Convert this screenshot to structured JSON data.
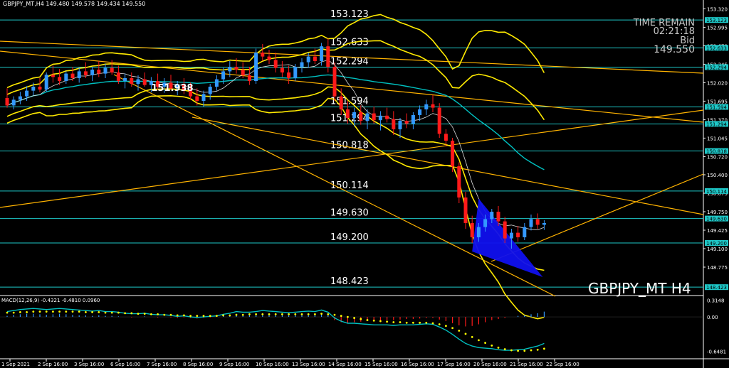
{
  "header": {
    "text": "GBPJPY_MT,H4  149.480 149.578 149.434 149.550"
  },
  "overlay": {
    "time_remain_label": "TIME REMAIN",
    "time_remain": "02:21:18",
    "bid_label": "Bid",
    "bid": "149.550"
  },
  "symbol_label": "GBPJPY_MT H4",
  "macd_label": "MACD(12,26,9) -0.4321 -0.4810 0.0960",
  "colors": {
    "bull": "#3399ff",
    "bear": "#ff1a1a",
    "band": "#ffea00",
    "trend": "#ffb300",
    "level": "#1ec8c8",
    "ma": "#00c0c0",
    "triangle": "#1010ee",
    "signal": "#ffff00"
  },
  "chart_data": {
    "type": "candlestick",
    "symbol": "GBPJPY_MT",
    "timeframe": "H4",
    "ylim": [
      148.3,
      153.35
    ],
    "y_ticks": [
      "153.320",
      "152.995",
      "152.670",
      "152.345",
      "152.020",
      "151.695",
      "151.370",
      "151.045",
      "150.720",
      "150.400",
      "150.075",
      "149.750",
      "149.425",
      "149.100",
      "148.775"
    ],
    "x_ticks": [
      "1 Sep 2021",
      "2 Sep 16:00",
      "3 Sep 16:00",
      "6 Sep 16:00",
      "7 Sep 16:00",
      "8 Sep 16:00",
      "9 Sep 16:00",
      "10 Sep 16:00",
      "13 Sep 16:00",
      "14 Sep 16:00",
      "15 Sep 16:00",
      "16 Sep 16:00",
      "17 Sep 16:00",
      "20 Sep 16:00",
      "21 Sep 16:00",
      "22 Sep 16:00"
    ],
    "levels": [
      {
        "value": 153.123,
        "label": "153.123"
      },
      {
        "value": 152.633,
        "label": "152.633"
      },
      {
        "value": 152.294,
        "label": "152.294"
      },
      {
        "value": 151.594,
        "label": "151.594"
      },
      {
        "value": 151.294,
        "label": "151.294"
      },
      {
        "value": 150.818,
        "label": "150.818"
      },
      {
        "value": 150.114,
        "label": "150.114"
      },
      {
        "value": 149.63,
        "label": "149.630"
      },
      {
        "value": 149.2,
        "label": "149.200"
      },
      {
        "value": 148.423,
        "label": "148.423"
      }
    ],
    "annotation": {
      "label": "151.938",
      "bar": 27,
      "value": 151.938
    },
    "candles": [
      [
        151.75,
        151.92,
        151.58,
        151.62
      ],
      [
        151.62,
        151.78,
        151.55,
        151.72
      ],
      [
        151.72,
        151.86,
        151.64,
        151.78
      ],
      [
        151.78,
        151.96,
        151.7,
        151.88
      ],
      [
        151.88,
        152.02,
        151.8,
        151.95
      ],
      [
        151.95,
        152.1,
        151.85,
        151.9
      ],
      [
        151.9,
        152.2,
        151.86,
        152.16
      ],
      [
        152.16,
        152.32,
        152.02,
        152.12
      ],
      [
        152.12,
        152.26,
        151.98,
        152.05
      ],
      [
        152.05,
        152.22,
        152.0,
        152.18
      ],
      [
        152.18,
        152.3,
        152.05,
        152.1
      ],
      [
        152.1,
        152.28,
        152.02,
        152.22
      ],
      [
        152.22,
        152.38,
        152.1,
        152.15
      ],
      [
        152.15,
        152.3,
        152.05,
        152.25
      ],
      [
        152.25,
        152.4,
        152.12,
        152.18
      ],
      [
        152.18,
        152.35,
        152.1,
        152.28
      ],
      [
        152.28,
        152.42,
        152.16,
        152.2
      ],
      [
        152.2,
        152.32,
        152.0,
        152.05
      ],
      [
        152.05,
        152.18,
        151.92,
        152.1
      ],
      [
        152.1,
        152.2,
        151.95,
        152.0
      ],
      [
        152.0,
        152.15,
        151.88,
        152.08
      ],
      [
        152.08,
        152.2,
        151.95,
        151.98
      ],
      [
        151.98,
        152.12,
        151.85,
        152.05
      ],
      [
        152.05,
        152.18,
        151.9,
        151.95
      ],
      [
        151.95,
        152.1,
        151.84,
        152.02
      ],
      [
        152.02,
        152.16,
        151.9,
        151.92
      ],
      [
        151.92,
        152.05,
        151.8,
        151.98
      ],
      [
        151.98,
        152.1,
        151.82,
        151.9
      ],
      [
        151.9,
        152.02,
        151.72,
        151.78
      ],
      [
        151.78,
        151.92,
        151.62,
        151.7
      ],
      [
        151.7,
        151.88,
        151.6,
        151.82
      ],
      [
        151.82,
        152.0,
        151.72,
        151.95
      ],
      [
        151.95,
        152.15,
        151.88,
        152.08
      ],
      [
        152.08,
        152.28,
        152.0,
        152.22
      ],
      [
        152.22,
        152.4,
        152.12,
        152.3
      ],
      [
        152.3,
        152.45,
        152.18,
        152.25
      ],
      [
        152.25,
        152.38,
        152.1,
        152.15
      ],
      [
        152.15,
        152.3,
        151.98,
        152.05
      ],
      [
        152.05,
        152.62,
        152.0,
        152.55
      ],
      [
        152.55,
        152.7,
        152.4,
        152.48
      ],
      [
        152.48,
        152.6,
        152.35,
        152.42
      ],
      [
        152.42,
        152.55,
        152.2,
        152.28
      ],
      [
        152.28,
        152.4,
        152.12,
        152.2
      ],
      [
        152.2,
        152.32,
        152.0,
        152.1
      ],
      [
        152.1,
        152.35,
        152.05,
        152.3
      ],
      [
        152.3,
        152.45,
        152.2,
        152.38
      ],
      [
        152.38,
        152.55,
        152.28,
        152.48
      ],
      [
        152.48,
        152.62,
        152.35,
        152.4
      ],
      [
        152.4,
        152.72,
        152.32,
        152.66
      ],
      [
        152.66,
        152.8,
        152.2,
        152.3
      ],
      [
        152.3,
        152.38,
        151.7,
        151.78
      ],
      [
        151.78,
        151.92,
        151.45,
        151.55
      ],
      [
        151.55,
        151.7,
        151.3,
        151.4
      ],
      [
        151.4,
        151.58,
        151.25,
        151.5
      ],
      [
        151.5,
        151.62,
        151.28,
        151.35
      ],
      [
        151.35,
        151.55,
        151.2,
        151.48
      ],
      [
        151.48,
        151.6,
        151.3,
        151.36
      ],
      [
        151.36,
        151.52,
        151.18,
        151.44
      ],
      [
        151.44,
        151.58,
        151.32,
        151.38
      ],
      [
        151.38,
        151.52,
        151.1,
        151.2
      ],
      [
        151.2,
        151.4,
        151.05,
        151.35
      ],
      [
        151.35,
        151.48,
        151.22,
        151.3
      ],
      [
        151.3,
        151.5,
        151.2,
        151.45
      ],
      [
        151.45,
        151.62,
        151.35,
        151.55
      ],
      [
        151.55,
        151.72,
        151.45,
        151.64
      ],
      [
        151.64,
        151.8,
        151.5,
        151.58
      ],
      [
        151.58,
        151.66,
        151.05,
        151.12
      ],
      [
        151.12,
        151.2,
        150.9,
        151.0
      ],
      [
        151.0,
        151.05,
        150.45,
        150.55
      ],
      [
        150.55,
        150.62,
        149.9,
        150.0
      ],
      [
        150.0,
        150.1,
        149.45,
        149.55
      ],
      [
        149.55,
        149.68,
        149.2,
        149.3
      ],
      [
        149.3,
        149.55,
        149.22,
        149.48
      ],
      [
        149.48,
        149.7,
        149.4,
        149.62
      ],
      [
        149.62,
        149.8,
        149.55,
        149.75
      ],
      [
        149.75,
        149.85,
        149.5,
        149.58
      ],
      [
        149.58,
        149.66,
        149.2,
        149.28
      ],
      [
        149.28,
        149.45,
        149.1,
        149.38
      ],
      [
        149.38,
        149.5,
        149.22,
        149.3
      ],
      [
        149.3,
        149.55,
        149.25,
        149.48
      ],
      [
        149.48,
        149.7,
        149.42,
        149.62
      ],
      [
        149.62,
        149.72,
        149.45,
        149.52
      ],
      [
        149.52,
        149.6,
        149.43,
        149.55
      ]
    ],
    "macd": {
      "label": "MACD(12,26,9) -0.4321 -0.4810 0.0960",
      "ylim": [
        -0.75,
        0.35
      ],
      "ticks": [
        "0.3148",
        "0.00",
        "-0.6481"
      ],
      "hist": [
        0.02,
        0.04,
        0.05,
        0.06,
        0.06,
        0.05,
        0.04,
        0.05,
        0.06,
        0.05,
        0.04,
        0.03,
        0.03,
        0.02,
        0.03,
        0.02,
        0.02,
        0.01,
        0.0,
        -0.01,
        0.0,
        0.01,
        0.0,
        -0.01,
        0.0,
        -0.01,
        -0.02,
        -0.01,
        -0.02,
        -0.03,
        -0.02,
        -0.01,
        0.0,
        0.02,
        0.04,
        0.06,
        0.05,
        0.04,
        0.05,
        0.07,
        0.06,
        0.05,
        0.04,
        0.03,
        0.04,
        0.05,
        0.06,
        0.05,
        0.07,
        0.04,
        -0.06,
        -0.1,
        -0.12,
        -0.1,
        -0.09,
        -0.08,
        -0.08,
        -0.07,
        -0.06,
        -0.06,
        -0.05,
        -0.04,
        -0.04,
        -0.03,
        -0.02,
        -0.02,
        -0.05,
        -0.08,
        -0.12,
        -0.16,
        -0.18,
        -0.17,
        -0.14,
        -0.1,
        -0.06,
        -0.04,
        -0.02,
        0.0,
        0.02,
        0.03,
        0.05,
        0.07,
        0.1
      ],
      "signal": [
        0.08,
        0.08,
        0.09,
        0.09,
        0.1,
        0.1,
        0.1,
        0.1,
        0.1,
        0.1,
        0.1,
        0.1,
        0.09,
        0.09,
        0.09,
        0.08,
        0.08,
        0.08,
        0.07,
        0.07,
        0.06,
        0.06,
        0.05,
        0.05,
        0.04,
        0.04,
        0.03,
        0.03,
        0.02,
        0.02,
        0.02,
        0.02,
        0.02,
        0.03,
        0.03,
        0.04,
        0.04,
        0.05,
        0.05,
        0.05,
        0.05,
        0.05,
        0.05,
        0.05,
        0.05,
        0.05,
        0.05,
        0.05,
        0.06,
        0.05,
        0.04,
        0.02,
        0.0,
        -0.02,
        -0.04,
        -0.06,
        -0.07,
        -0.08,
        -0.09,
        -0.1,
        -0.1,
        -0.11,
        -0.11,
        -0.11,
        -0.11,
        -0.12,
        -0.14,
        -0.17,
        -0.21,
        -0.26,
        -0.32,
        -0.38,
        -0.44,
        -0.49,
        -0.54,
        -0.58,
        -0.61,
        -0.63,
        -0.64,
        -0.64,
        -0.63,
        -0.62,
        -0.6
      ],
      "macd_line": [
        0.1,
        0.12,
        0.14,
        0.15,
        0.16,
        0.15,
        0.14,
        0.15,
        0.16,
        0.15,
        0.14,
        0.13,
        0.12,
        0.11,
        0.12,
        0.1,
        0.1,
        0.09,
        0.07,
        0.06,
        0.06,
        0.07,
        0.05,
        0.04,
        0.04,
        0.03,
        0.01,
        0.02,
        0.0,
        -0.01,
        0.0,
        0.01,
        0.02,
        0.05,
        0.07,
        0.1,
        0.09,
        0.09,
        0.1,
        0.12,
        0.11,
        0.1,
        0.09,
        0.08,
        0.09,
        0.1,
        0.11,
        0.1,
        0.13,
        0.09,
        -0.02,
        -0.08,
        -0.12,
        -0.12,
        -0.13,
        -0.14,
        -0.15,
        -0.15,
        -0.15,
        -0.16,
        -0.15,
        -0.15,
        -0.15,
        -0.14,
        -0.13,
        -0.14,
        -0.19,
        -0.25,
        -0.33,
        -0.42,
        -0.5,
        -0.55,
        -0.58,
        -0.59,
        -0.6,
        -0.62,
        -0.63,
        -0.63,
        -0.62,
        -0.61,
        -0.58,
        -0.55,
        -0.5
      ]
    }
  }
}
